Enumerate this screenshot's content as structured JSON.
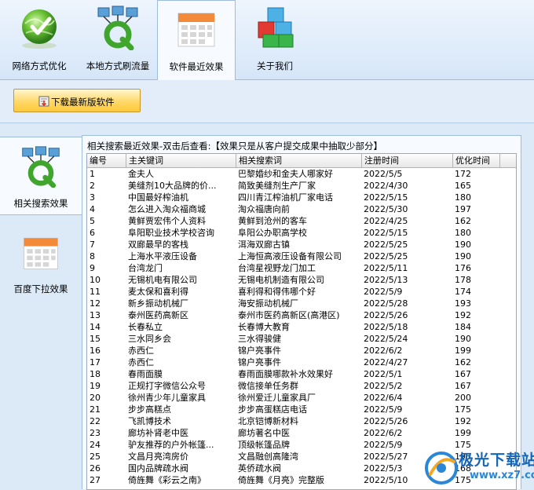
{
  "tabs": [
    {
      "label": "网络方式优化",
      "icon": "globe-check-icon",
      "active": false
    },
    {
      "label": "本地方式刷流量",
      "icon": "network-q-icon",
      "active": false
    },
    {
      "label": "软件最近效果",
      "icon": "calendar-icon",
      "active": true
    },
    {
      "label": "关于我们",
      "icon": "cubes-icon",
      "active": false
    }
  ],
  "toolbar": {
    "download_label": "下载最新版软件",
    "download_icon": "download-icon"
  },
  "side_nav": [
    {
      "label": "相关搜索效果",
      "icon": "network-q-icon",
      "active": true
    },
    {
      "label": "百度下拉效果",
      "icon": "calendar-icon",
      "active": false
    }
  ],
  "panel": {
    "title": "相关搜索最近效果-双击后查看:【效果只是从客户提交成果中抽取少部分】"
  },
  "table": {
    "columns": [
      "编号",
      "主关键词",
      "相关搜索词",
      "注册时间",
      "优化时间"
    ],
    "rows": [
      [
        "1",
        "金夫人",
        "巴黎婚纱和金夫人哪家好",
        "2022/5/5",
        "172"
      ],
      [
        "2",
        "美缝剂10大品牌的价...",
        "简致美缝剂生产厂家",
        "2022/4/30",
        "165"
      ],
      [
        "3",
        "中国最好榨油机",
        "四川青江榨油机厂家电话",
        "2022/5/15",
        "180"
      ],
      [
        "4",
        "怎么进入淘众福商城",
        "淘众福唐向前",
        "2022/5/30",
        "197"
      ],
      [
        "5",
        "黄鲜贾宏伟个人资料",
        "黄鲜到沧州的客车",
        "2022/4/25",
        "162"
      ],
      [
        "6",
        "阜阳职业技术学校咨询",
        "阜阳公办职高学校",
        "2022/5/15",
        "180"
      ],
      [
        "7",
        "双廊最早的客栈",
        "洱海双廊古镇",
        "2022/5/25",
        "190"
      ],
      [
        "8",
        "上海水平液压设备",
        "上海恒高液压设备有限公司",
        "2022/5/25",
        "190"
      ],
      [
        "9",
        "台湾龙门",
        "台湾星视野龙门加工",
        "2022/5/11",
        "176"
      ],
      [
        "10",
        "无锡机电有限公司",
        "无锡电机制造有限公司",
        "2022/5/13",
        "178"
      ],
      [
        "11",
        "麦太保和喜利得",
        "喜利得和得伟哪个好",
        "2022/5/9",
        "174"
      ],
      [
        "12",
        "新乡振动机械厂",
        "海安振动机械厂",
        "2022/5/28",
        "193"
      ],
      [
        "13",
        "泰州医药高新区",
        "泰州市医药高新区(高港区)",
        "2022/5/26",
        "192"
      ],
      [
        "14",
        "长春私立",
        "长春博大教育",
        "2022/5/18",
        "184"
      ],
      [
        "15",
        "三水同乡会",
        "三水得骏健",
        "2022/5/24",
        "190"
      ],
      [
        "16",
        "赤西仁",
        "锦户亮事件",
        "2022/6/2",
        "199"
      ],
      [
        "17",
        "赤西仁",
        "锦户亮事件",
        "2022/4/27",
        "162"
      ],
      [
        "18",
        "春雨面膜",
        "春雨面膜哪款补水效果好",
        "2022/5/1",
        "167"
      ],
      [
        "19",
        "正规打字微信公众号",
        "微信接单任务群",
        "2022/5/2",
        "167"
      ],
      [
        "20",
        "徐州青少年儿童家具",
        "徐州爱迁儿童家具厂",
        "2022/6/4",
        "200"
      ],
      [
        "21",
        "步步高糕点",
        "步步高蛋糕店电话",
        "2022/5/9",
        "175"
      ],
      [
        "22",
        "飞凯博技术",
        "北京铠博新材料",
        "2022/5/26",
        "192"
      ],
      [
        "23",
        "廊坊补肾老中医",
        "廊坊著名中医",
        "2022/6/2",
        "199"
      ],
      [
        "24",
        "驴友推荐的户外帐篷...",
        "顶级帐篷品牌",
        "2022/5/9",
        "175"
      ],
      [
        "25",
        "文昌月亮湾房价",
        "文昌融创高隆湾",
        "2022/5/27",
        "193"
      ],
      [
        "26",
        "国内品牌疏水阀",
        "英侨疏水阀",
        "2022/5/3",
        "168"
      ],
      [
        "27",
        "倚旌舞《彩云之南》",
        "倚旌舞《月亮》完整版",
        "2022/5/10",
        "175"
      ]
    ]
  },
  "watermark": {
    "brand": "极光下载站",
    "url": "www.xz7.com"
  },
  "colors": {
    "background": "#dce9f7",
    "panel": "#f7fbff",
    "border": "#9fbcdd",
    "button": "#ffd868",
    "brand": "#1566b8"
  }
}
